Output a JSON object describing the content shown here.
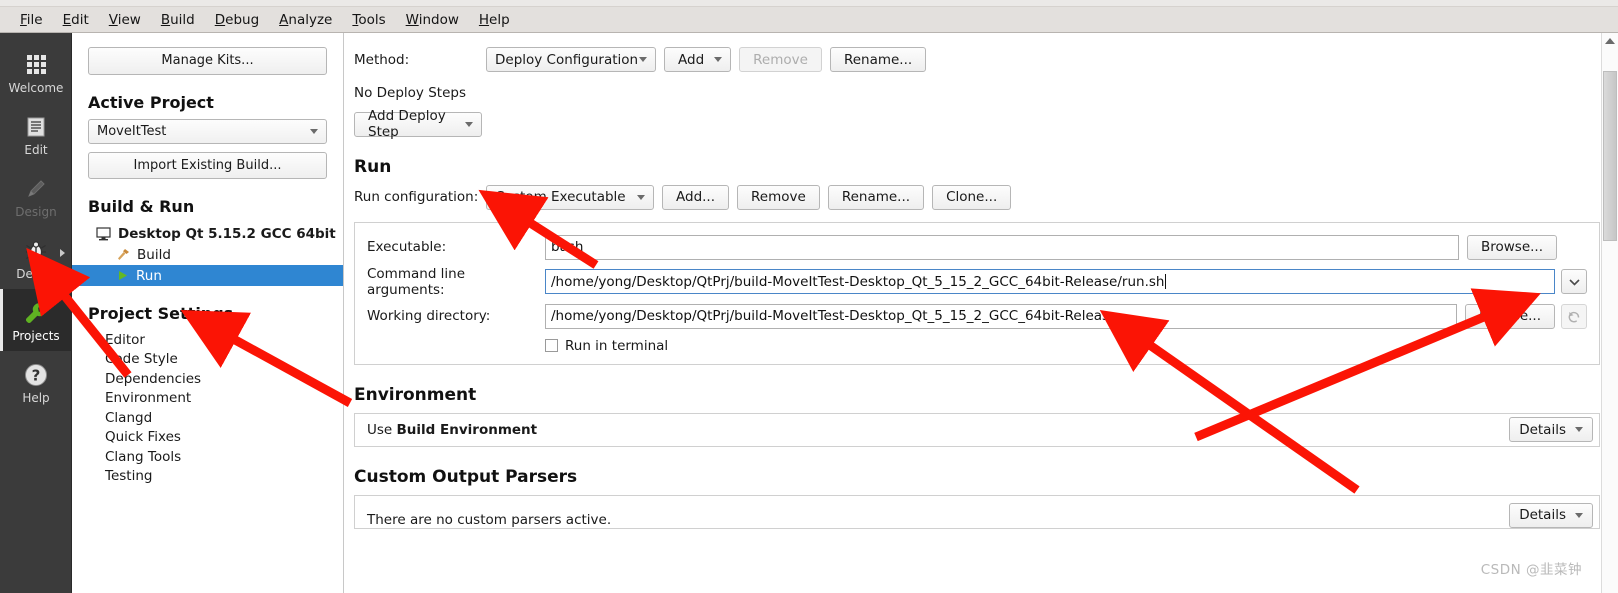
{
  "menubar": {
    "items": [
      {
        "label": "File",
        "mnemonic": "F"
      },
      {
        "label": "Edit",
        "mnemonic": "E"
      },
      {
        "label": "View",
        "mnemonic": "V"
      },
      {
        "label": "Build",
        "mnemonic": "B"
      },
      {
        "label": "Debug",
        "mnemonic": "D"
      },
      {
        "label": "Analyze",
        "mnemonic": "A"
      },
      {
        "label": "Tools",
        "mnemonic": "T"
      },
      {
        "label": "Window",
        "mnemonic": "W"
      },
      {
        "label": "Help",
        "mnemonic": "H"
      }
    ]
  },
  "modebar": {
    "items": [
      {
        "label": "Welcome",
        "icon": "grid-icon",
        "state": "normal"
      },
      {
        "label": "Edit",
        "icon": "document-icon",
        "state": "normal"
      },
      {
        "label": "Design",
        "icon": "pencil-icon",
        "state": "disabled"
      },
      {
        "label": "Debug",
        "icon": "bug-icon",
        "state": "normal"
      },
      {
        "label": "Projects",
        "icon": "wrench-icon",
        "state": "selected"
      },
      {
        "label": "Help",
        "icon": "question-circle-icon",
        "state": "normal"
      }
    ],
    "accent_selected": "#2b2b2b",
    "wrench_color": "#5fb322"
  },
  "projectpanel": {
    "manage_kits_label": "Manage Kits...",
    "active_project_heading": "Active Project",
    "active_project_value": "MoveItTest",
    "import_existing_build_label": "Import Existing Build...",
    "build_and_run_heading": "Build & Run",
    "kit_label": "Desktop Qt 5.15.2 GCC 64bit",
    "kit_children": [
      {
        "label": "Build",
        "icon": "hammer-icon",
        "selected": false
      },
      {
        "label": "Run",
        "icon": "play-icon",
        "selected": true
      }
    ],
    "project_settings_heading": "Project Settings",
    "settings_items": [
      "Editor",
      "Code Style",
      "Dependencies",
      "Environment",
      "Clangd",
      "Quick Fixes",
      "Clang Tools",
      "Testing"
    ],
    "selection_color": "#2f86d2"
  },
  "deploy": {
    "method_label": "Method:",
    "method_value": "Deploy Configuration",
    "add_label": "Add",
    "remove_label": "Remove",
    "rename_label": "Rename...",
    "no_deploy_steps_text": "No Deploy Steps",
    "add_deploy_step_label": "Add Deploy Step"
  },
  "run": {
    "heading": "Run",
    "run_configuration_label": "Run configuration:",
    "run_configuration_value": "Custom Executable",
    "add_label": "Add...",
    "remove_label": "Remove",
    "rename_label": "Rename...",
    "clone_label": "Clone...",
    "executable_label": "Executable:",
    "executable_value": "bash",
    "executable_browse_label": "Browse...",
    "command_line_arguments_label": "Command line arguments:",
    "command_line_arguments_value": "/home/yong/Desktop/QtPrj/build-MoveItTest-Desktop_Qt_5_15_2_GCC_64bit-Release/run.sh",
    "working_directory_label": "Working directory:",
    "working_directory_value": "/home/yong/Desktop/QtPrj/build-MoveItTest-Desktop_Qt_5_15_2_GCC_64bit-Release",
    "working_directory_browse_label": "Browse...",
    "run_in_terminal_label": "Run in terminal",
    "run_in_terminal_checked": false,
    "args_history_icon": "chevron-down-icon",
    "workdir_reset_icon": "reset-arrow-icon"
  },
  "environment": {
    "heading": "Environment",
    "use_prefix": "Use ",
    "use_value": "Build Environment",
    "details_label": "Details"
  },
  "parsers": {
    "heading": "Custom Output Parsers",
    "empty_text": "There are no custom parsers active.",
    "details_label": "Details"
  },
  "scrollbar": {
    "up_arrow_icon": "triangle-up-icon"
  },
  "watermark": {
    "text": "CSDN @韭菜钟"
  },
  "annotations": {
    "arrow_color": "#fb1405",
    "arrows": [
      {
        "name": "arrow-to-projects-mode"
      },
      {
        "name": "arrow-to-run-tree-item"
      },
      {
        "name": "arrow-to-run-configuration-combo"
      },
      {
        "name": "arrow-to-command-line-arguments"
      },
      {
        "name": "arrow-to-working-directory"
      }
    ]
  }
}
